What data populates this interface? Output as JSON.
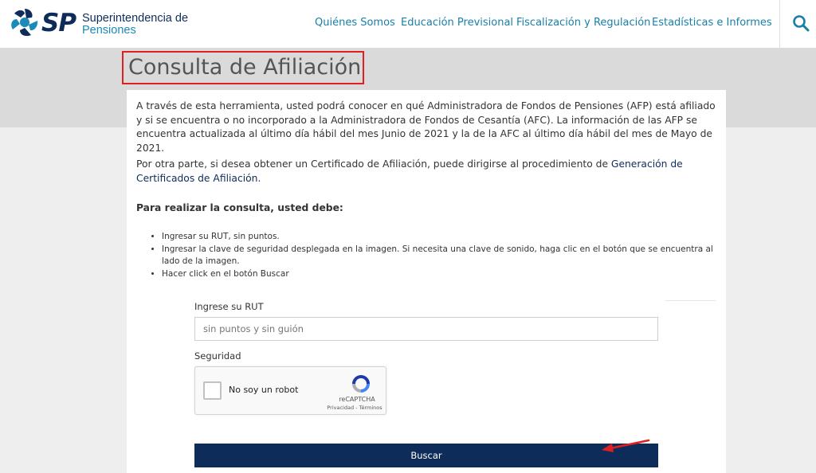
{
  "header": {
    "logo_sp": "SP",
    "logo_line1": "Superintendencia de",
    "logo_line2": "Pensiones",
    "nav": [
      "Quiénes Somos",
      "Educación Previsional",
      "Fiscalización y Regulación",
      "Estadísticas e Informes"
    ],
    "search_icon": "search-icon"
  },
  "page": {
    "title": "Consulta de Afiliación",
    "paragraph1": "A través de esta herramienta, usted podrá conocer en qué Administradora de Fondos de Pensiones (AFP) está afiliado y si se encuentra o no incorporado a la Administradora de Fondos de Cesantía (AFC). La información de las AFP se encuentra actualizada al último día hábil del mes Junio de 2021 y la de la AFC al último día hábil del mes de Mayo de 2021.",
    "paragraph2_prefix": "Por otra parte, si desea obtener un Certificado de Afiliación, puede dirigirse al procedimiento de ",
    "paragraph2_link": "Generación de Certificados de Afiliación",
    "paragraph2_suffix": ".",
    "instructions_title": "Para realizar la consulta, usted debe:",
    "steps": [
      "Ingresar su RUT, sin puntos.",
      "Ingresar la clave de seguridad desplegada en la imagen. Si necesita una clave de sonido, haga clic en el botón que se encuentra al lado de la imagen.",
      "Hacer click en el botón Buscar"
    ]
  },
  "form": {
    "rut_label": "Ingrese su RUT",
    "rut_placeholder": "sin puntos y sin guión",
    "rut_value": "",
    "security_label": "Seguridad",
    "captcha_label": "No soy un robot",
    "captcha_brand": "reCAPTCHA",
    "captcha_terms": "Privacidad - Términos",
    "submit_label": "Buscar"
  },
  "colors": {
    "brand_navy": "#0d2c5a",
    "brand_cyan": "#1b8ab8",
    "nav_link": "#1a7fa8",
    "highlight_red": "#e02020"
  }
}
